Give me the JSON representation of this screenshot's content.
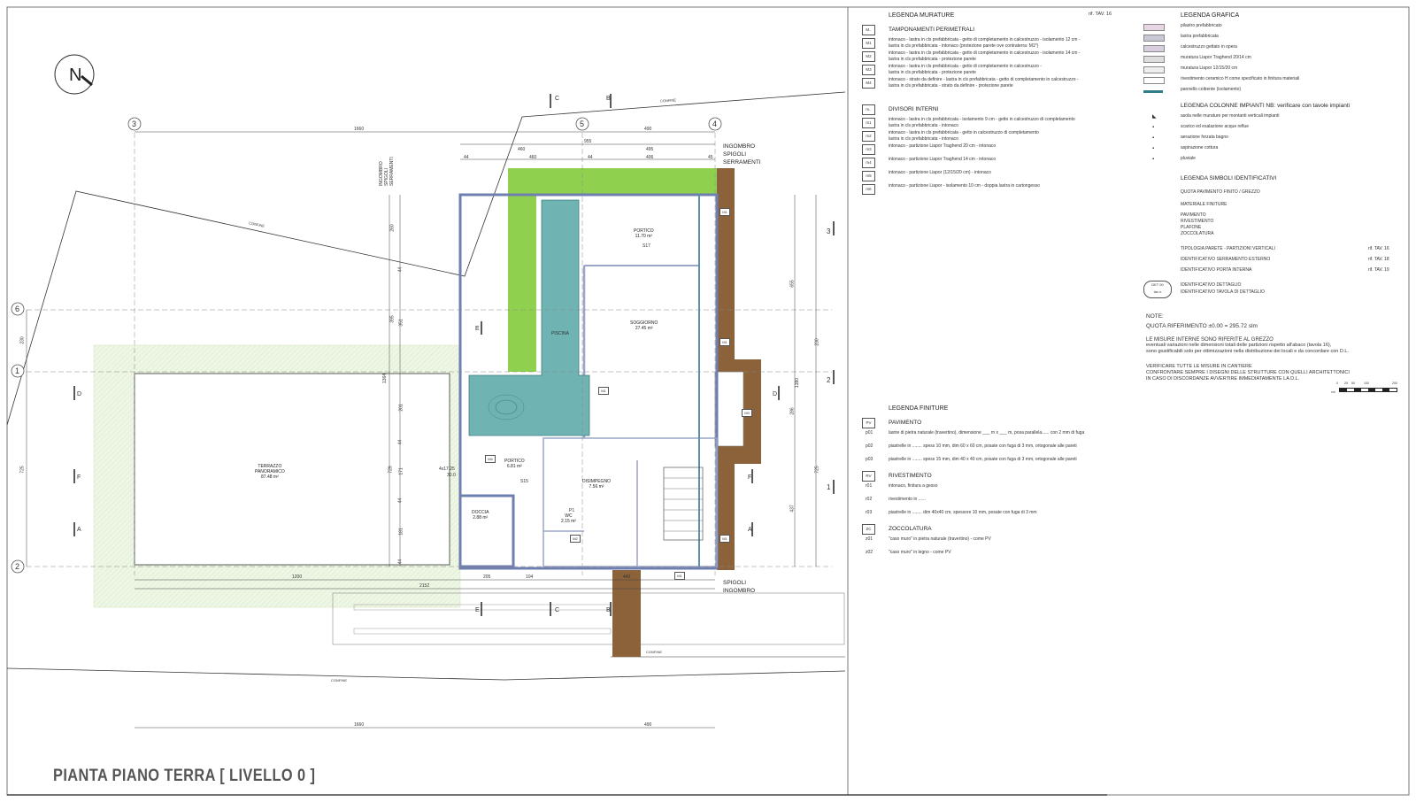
{
  "title": "PIANTA PIANO TERRA   [ LIVELLO 0 ]",
  "north_label": "N",
  "grid_labels": {
    "g3": "3",
    "g5": "5",
    "g4": "4",
    "g6": "6",
    "g1": "1",
    "g2": "2",
    "r3": "3",
    "r2": "2",
    "r1": "1"
  },
  "section_marks": {
    "c": "C",
    "b": "B",
    "d": "D",
    "e": "E",
    "f": "F",
    "a": "A"
  },
  "confine": "CONFINE",
  "ingombro_left": [
    "INGOMBRO",
    "SPIGOLI",
    "SERRAMENTI"
  ],
  "ingombro_top": [
    "INGOMBRO",
    "SPIGOLI",
    "SERRAMENTI"
  ],
  "ingombro_bottom": [
    "SPIGOLI",
    "INGOMBRO"
  ],
  "dims": {
    "top_1660": "1660",
    "top_490": "490",
    "top_955": "955",
    "top_460a": "460",
    "top_495": "495",
    "top_44a": "44",
    "top_460b": "460",
    "top_44b": "44",
    "top_406": "406",
    "top_45": "45",
    "bot_1200": "1200",
    "bot_2152": "2152",
    "bot_205": "205",
    "bot_104": "104",
    "bot_442": "442",
    "bot2_1660": "1660",
    "bot2_490": "490",
    "left_725": "725",
    "left_230": "230",
    "l_260": "260",
    "l_44a": "44",
    "l_395": "395",
    "l_351": "351",
    "l_1364": "1364",
    "l_201": "201",
    "l_44b": "44",
    "l_171": "171",
    "l_729": "729",
    "l_44c": "44",
    "l_181": "181",
    "l_44d": "44",
    "r_655": "655",
    "r_230": "230",
    "r_1380": "1380",
    "r_725": "725",
    "r_286": "286",
    "r_437": "437"
  },
  "rooms": {
    "portico_top": {
      "name": "PORTICO",
      "area": "11.70 m²"
    },
    "soggiorno": {
      "name": "SOGGIORNO",
      "area": "27.45 m²"
    },
    "piscina": {
      "name": "PISCINA"
    },
    "terrazzo": {
      "name": "TERRAZZO",
      "name2": "PANORAMICO",
      "area": "87.48 m²"
    },
    "portico_mid": {
      "name": "PORTICO",
      "area": "6.81 m²"
    },
    "disimpegno": {
      "name": "DISIMPEGNO",
      "area": "7.56 m²"
    },
    "wc": {
      "name": "WC",
      "area": "2.15 m²"
    },
    "doccia": {
      "name": "DOCCIA",
      "area": "2.88 m²"
    }
  },
  "tags": {
    "m1": "M1",
    "m1b": "M1",
    "m1c": "M1",
    "m1d": "M1",
    "m1e": "M1",
    "m2": "M2",
    "m3": "M3",
    "m4": "M4",
    "s17": "S17",
    "s15": "S15",
    "p1": "P1",
    "stair": "4x17.25",
    "stair_b": "30.0"
  },
  "legend_murature": {
    "title": "LEGENDA MURATURE",
    "ref": "rif. TAV. 16",
    "groups": [
      {
        "code": "M..",
        "title": "TAMPONAMENTI PERIMETRALI",
        "items": [
          {
            "code": "M1",
            "text": [
              "intonaco - lastra in cls prefabbricata - getto di completamento in calcestruzzo - isolamento 12 cm -",
              "lastra in cls prefabbricata - intonaco (protezione parete ove contraterra: M1*)"
            ]
          },
          {
            "code": "M2",
            "text": [
              "intonaco - lastra in cls prefabbricata - getto di completamento in calcestruzzo - isolamento 14 cm -",
              "lastra in cls prefabbricata - protezione parete"
            ]
          },
          {
            "code": "M3",
            "text": [
              "intonaco - lastra in cls prefabbricata - getto di completamento in calcestruzzo -",
              "lastra in cls prefabbricata - protezione parete"
            ]
          },
          {
            "code": "M4",
            "text": [
              "intonaco - strato da definire - lastra in cls prefabbricata - getto di completamento in calcestruzzo -",
              "lastra in cls prefabbricata - strato da definire - protezione parete"
            ]
          }
        ]
      },
      {
        "code": "m..",
        "title": "DIVISORI INTERNI",
        "items": [
          {
            "code": "m1",
            "text": [
              "intonaco - lastra in cls prefabbricata - isolamento 9 cm - getto in calcestruzzo di completamento",
              "lastra in cls prefabbricata - intonaco"
            ]
          },
          {
            "code": "m2",
            "text": [
              "intonaco - lastra in cls prefabbricata - getto in calcestruzzo di completamento",
              "lastra in cls prefabbricata - intonaco"
            ]
          },
          {
            "code": "m3",
            "text": [
              "intonaco - partizione Liapor Traghend 20 cm - intonaco"
            ]
          },
          {
            "code": "m4",
            "text": [
              "intonaco - partizione Liapor Traghend 14 cm - intonaco"
            ]
          },
          {
            "code": "m5",
            "text": [
              "intonaco - partizione Liapor (12/15/20 cm) - intonaco"
            ]
          },
          {
            "code": "m6",
            "text": [
              "intonaco - partizione Liapor - isolamento 10 cm - doppia lastra in cartongesso"
            ]
          }
        ]
      }
    ]
  },
  "legend_grafica": {
    "title": "LEGENDA GRAFICA",
    "items": [
      {
        "label": "pilastro prefabbricato",
        "color": "#e8d6e6"
      },
      {
        "label": "lastra prefabbricata",
        "color": "#c9c9d6"
      },
      {
        "label": "calcestruzzo gettato in opera",
        "color": "#d9cde0"
      },
      {
        "label": "muratura Liapor Traghend 20/14 cm",
        "color": "#dddddd"
      },
      {
        "label": "muratura Liapor 12/15/20 cm",
        "color": "#eeeeee"
      },
      {
        "label": "rivestimento ceramico H come specificato in finitura materiali",
        "color": "#ffffff"
      },
      {
        "label": "pannello coibente (isolamento)",
        "color": "#2f7d8a"
      }
    ]
  },
  "legend_colonne": {
    "title": "LEGENDA  COLONNE  IMPIANTI NB: verificare con tavole impianti",
    "items": [
      "asola nelle murature per montanti verticali impianti",
      "scarico ed esalazione acque reflue",
      "aerazione forzata bagno",
      "aspirazione cottura",
      "pluviale"
    ]
  },
  "legend_simboli": {
    "title": "LEGENDA SIMBOLI IDENTIFICATIVI",
    "quota": "QUOTA PAVIMENTO FINITO / GREZZO",
    "materiale_title": "MATERIALE FINITURE",
    "materiale": [
      "PAVIMENTO",
      "RIVESTIMENTO",
      "PLAFONE",
      "ZOCCOLATURA"
    ],
    "rows": [
      {
        "label": "TIPOLOGIA PARETE - PARTIZIONI VERTICALI",
        "ref": "rif. TAV. 16"
      },
      {
        "label": "IDENTIFICATIVO SERRAMENTO ESTERNO",
        "ref": "rif. TAV. 18"
      },
      {
        "label": "IDENTIFICATIVO PORTA INTERNA",
        "ref": "rif. TAV. 19"
      }
    ],
    "det_code": "DET 00",
    "det_sub": "tav n",
    "det": [
      "IDENTIFICATIVO DETTAGLIO",
      "IDENTIFICATIVO TAVOLA DI DETTAGLIO"
    ]
  },
  "note": {
    "title": "NOTE:",
    "quota_ref": "QUOTA RIFERIMENTO   ±0.00  =  295.72 slm",
    "lines1": [
      "LE MISURE INTERNE SONO RIFERITE AL GREZZO",
      "eventuali variazioni nelle dimensioni totali delle partizioni rispetto all'abaco (tavola 16),",
      "sono giustificabili solo per ottimizzazioni nella distribuzione dei locali e da concordare con D.L."
    ],
    "lines2": [
      "VERIFICARE TUTTE LE MISURE IN CANTIERE",
      "CONFRONTARE SEMPRE I DISEGNI DELLE STRUTTURE CON QUELLI ARCHITETTONICI",
      "IN CASO DI DISCORDANZE AVVERTIRE IMMEDIATAMENTE LA D.L."
    ],
    "scale": [
      "0",
      "25",
      "50",
      "100",
      "200"
    ],
    "scale_unit": "cm"
  },
  "legend_finiture": {
    "title": "LEGENDA FINITURE",
    "groups": [
      {
        "code": "PV",
        "title": "PAVIMENTO",
        "items": [
          {
            "code": "p01",
            "text": "lastre di pietra naturale (travertino), dimensione ___ m x ___ m, posa parallela...... con 2 mm di fuga"
          },
          {
            "code": "p02",
            "text": "piastrelle in ........ spess 10 mm, dim 60 x 60 cm, posate con fuga di 3 mm, ortogonale alle pareti"
          },
          {
            "code": "p03",
            "text": "piastrelle in ........ spess 15 mm, dim 40 x 40 cm, posate con fuga di 3 mm, ortogonale alle pareti"
          }
        ]
      },
      {
        "code": "RV",
        "title": "RIVESTIMENTO",
        "items": [
          {
            "code": "r01",
            "text": "intonaco, finitura a gesso"
          },
          {
            "code": "r02",
            "text": "rivestimento in ......"
          },
          {
            "code": "r03",
            "text": "piastrelle in ........ dim 40x40 cm, spessore 10 mm,  posate con fuga di 3 mm"
          }
        ]
      },
      {
        "code": "ZC",
        "title": "ZOCCOLATURA",
        "items": [
          {
            "code": "z01",
            "text": "\"caso muro\" in pietra naturale (travertino) - come PV"
          },
          {
            "code": "z02",
            "text": "\"caso muro\" in legno - come PV"
          }
        ]
      }
    ]
  },
  "colors": {
    "green": "#8fd14f",
    "brown": "#8b6239",
    "pool": "#6fb3b3",
    "terrace_hatch": "#e8f3dc",
    "wall": "#9aa6c7"
  }
}
